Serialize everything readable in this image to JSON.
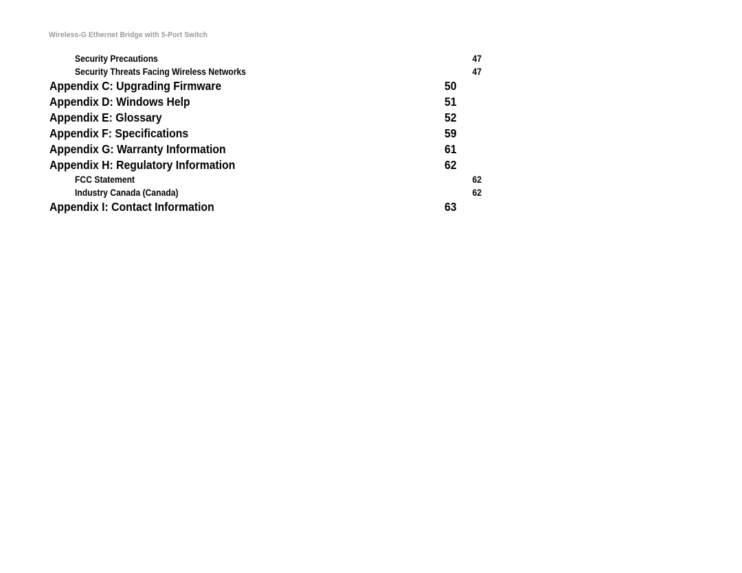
{
  "document": {
    "running_header": "Wireless-G Ethernet Bridge with 5-Port Switch",
    "header_color": "#9a9a9a",
    "text_color": "#000000",
    "background_color": "#ffffff"
  },
  "toc": {
    "entries": [
      {
        "title": "Security Precautions",
        "page": "47",
        "level": 2
      },
      {
        "title": "Security Threats Facing Wireless Networks",
        "page": "47",
        "level": 2
      },
      {
        "title": "Appendix C: Upgrading Firmware",
        "page": "50",
        "level": 1
      },
      {
        "title": "Appendix D: Windows Help",
        "page": "51",
        "level": 1
      },
      {
        "title": "Appendix E: Glossary",
        "page": "52",
        "level": 1
      },
      {
        "title": "Appendix F: Specifications",
        "page": "59",
        "level": 1
      },
      {
        "title": "Appendix G: Warranty Information",
        "page": "61",
        "level": 1
      },
      {
        "title": "Appendix H: Regulatory Information",
        "page": "62",
        "level": 1
      },
      {
        "title": "FCC Statement",
        "page": "62",
        "level": 2
      },
      {
        "title": "Industry Canada (Canada)",
        "page": "62",
        "level": 2
      },
      {
        "title": "Appendix I: Contact Information",
        "page": "63",
        "level": 1
      }
    ]
  }
}
